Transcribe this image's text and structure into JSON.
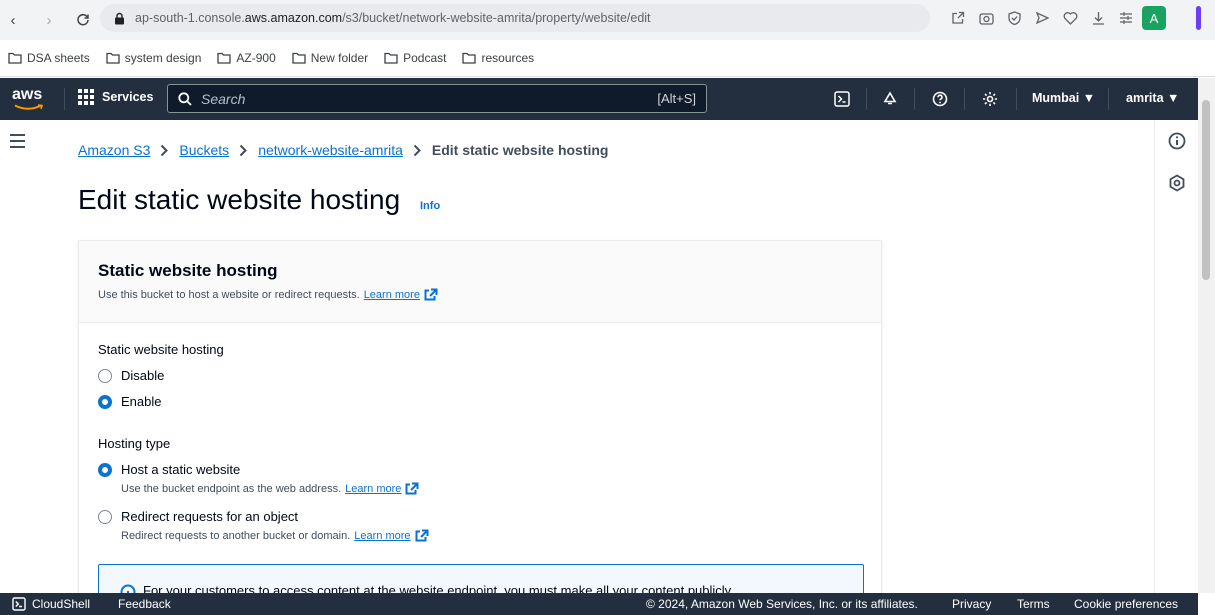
{
  "browser": {
    "url_prefix": "ap-south-1.console.",
    "url_host": "aws.amazon.com",
    "url_path": "/s3/bucket/network-website-amrita/property/website/edit",
    "profile_initial": "A",
    "bookmarks": [
      "DSA sheets",
      "system design",
      "AZ-900",
      "New folder",
      "Podcast",
      "resources"
    ]
  },
  "aws_nav": {
    "logo": "aws",
    "services_label": "Services",
    "search_placeholder": "Search",
    "search_shortcut": "[Alt+S]",
    "region": "Mumbai ▼",
    "user": "amrita ▼"
  },
  "breadcrumb": [
    "Amazon S3",
    "Buckets",
    "network-website-amrita",
    "Edit static website hosting"
  ],
  "page": {
    "title": "Edit static website hosting",
    "info": "Info"
  },
  "card": {
    "title": "Static website hosting",
    "description": "Use this bucket to host a website or redirect requests.",
    "learn_more": "Learn more",
    "hosting_label": "Static website hosting",
    "hosting_options": [
      "Disable",
      "Enable"
    ],
    "hosting_selected": "Enable",
    "type_label": "Hosting type",
    "type_options": [
      {
        "label": "Host a static website",
        "desc": "Use the bucket endpoint as the web address.",
        "link": "Learn more"
      },
      {
        "label": "Redirect requests for an object",
        "desc": "Redirect requests to another bucket or domain.",
        "link": "Learn more"
      }
    ],
    "type_selected": "Host a static website",
    "alert_text": "For your customers to access content at the website endpoint, you must make all your content publicly"
  },
  "footer": {
    "cloudshell": "CloudShell",
    "feedback": "Feedback",
    "copyright": "© 2024, Amazon Web Services, Inc. or its affiliates.",
    "privacy": "Privacy",
    "terms": "Terms",
    "cookie": "Cookie preferences"
  },
  "colors": {
    "aws_nav": "#232f3e",
    "link": "#0972d3",
    "aws_orange": "#ff9900"
  }
}
